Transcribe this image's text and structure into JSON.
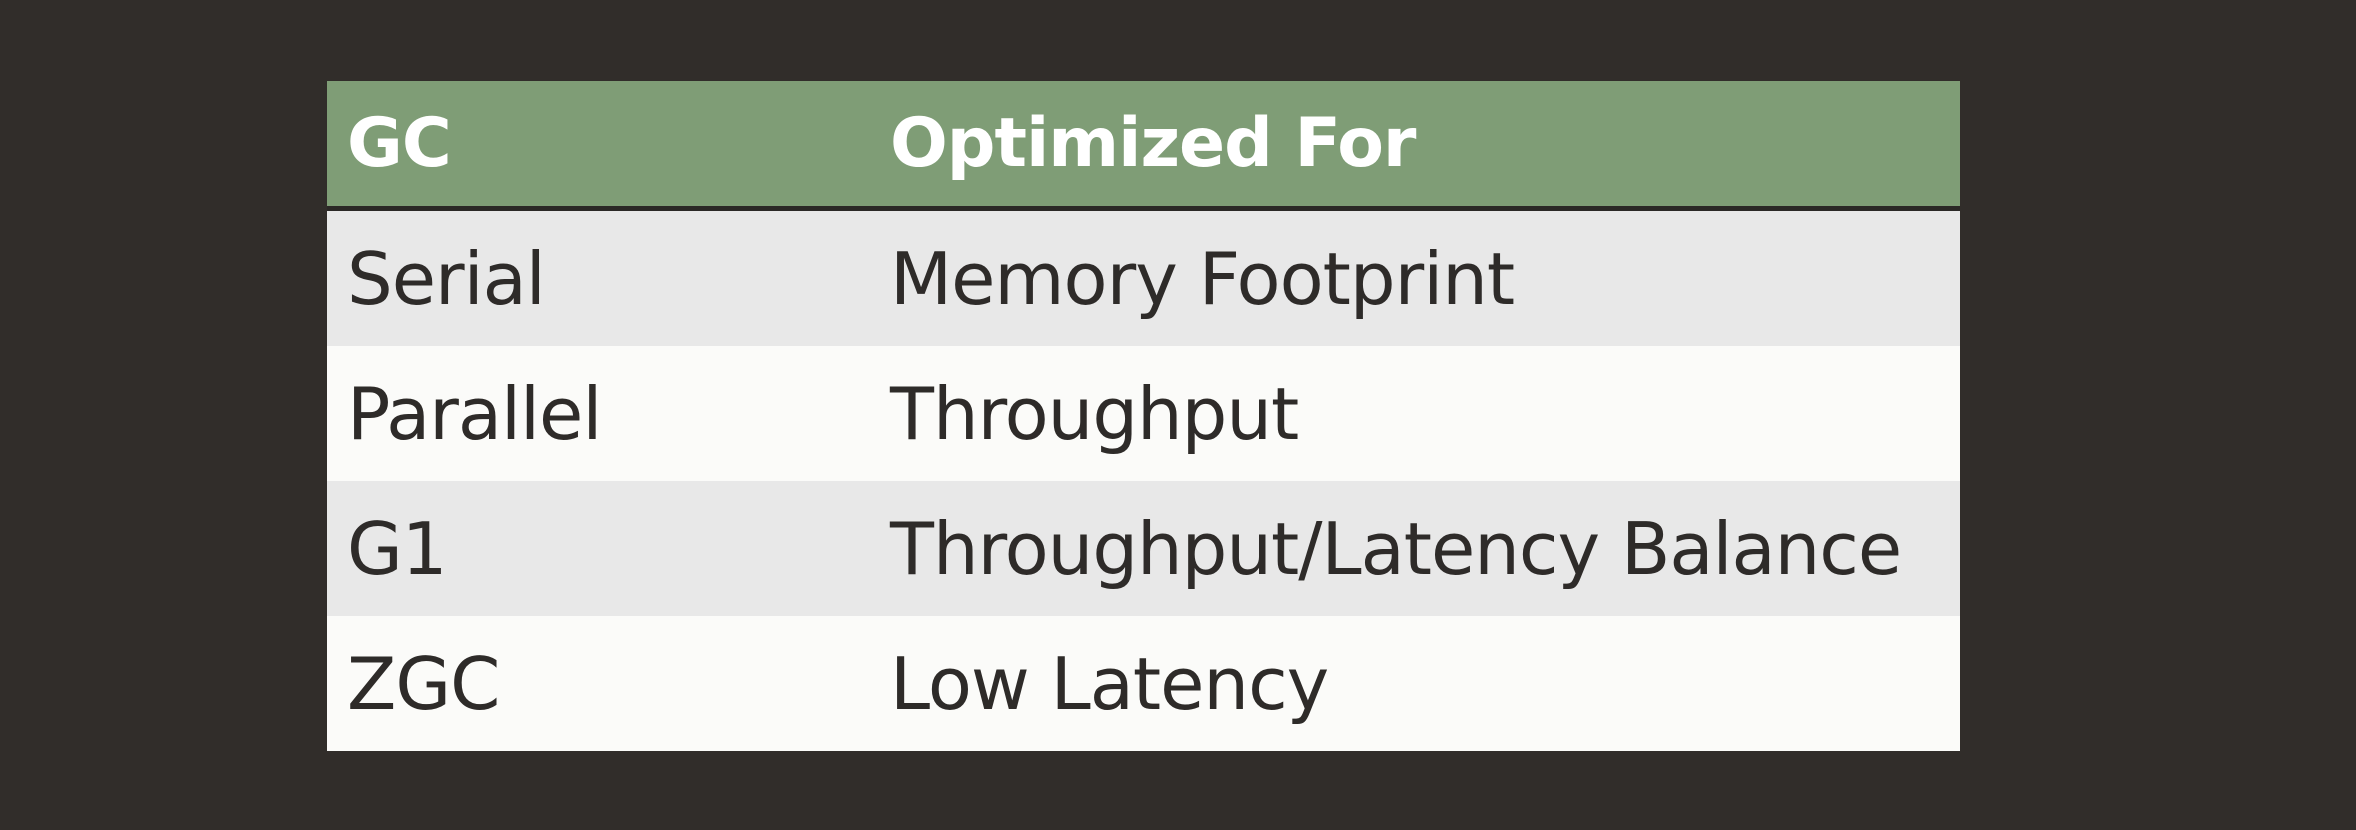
{
  "table": {
    "headers": [
      "GC",
      "Optimized For"
    ],
    "rows": [
      [
        "Serial",
        "Memory Footprint"
      ],
      [
        "Parallel",
        "Throughput"
      ],
      [
        "G1",
        "Throughput/Latency Balance"
      ],
      [
        "ZGC",
        "Low Latency"
      ]
    ]
  },
  "colors": {
    "background": "#312d2a",
    "header_background": "#7f9d76",
    "row_shaded": "#e8e8e8",
    "row_light": "#fbfbf9",
    "text": "#2e2b29",
    "header_text": "#ffffff"
  }
}
